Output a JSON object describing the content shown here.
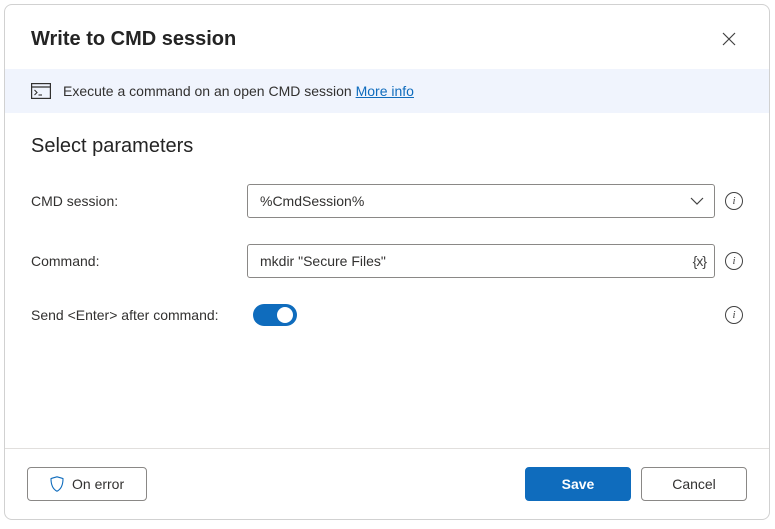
{
  "dialog": {
    "title": "Write to CMD session"
  },
  "banner": {
    "text": "Execute a command on an open CMD session ",
    "moreInfo": "More info"
  },
  "section": {
    "title": "Select parameters"
  },
  "fields": {
    "cmdSession": {
      "label": "CMD session:",
      "value": "%CmdSession%"
    },
    "command": {
      "label": "Command:",
      "value": "mkdir \"Secure Files\""
    },
    "sendEnter": {
      "label": "Send <Enter> after command:",
      "state": "on"
    }
  },
  "footer": {
    "onError": "On error",
    "save": "Save",
    "cancel": "Cancel"
  }
}
